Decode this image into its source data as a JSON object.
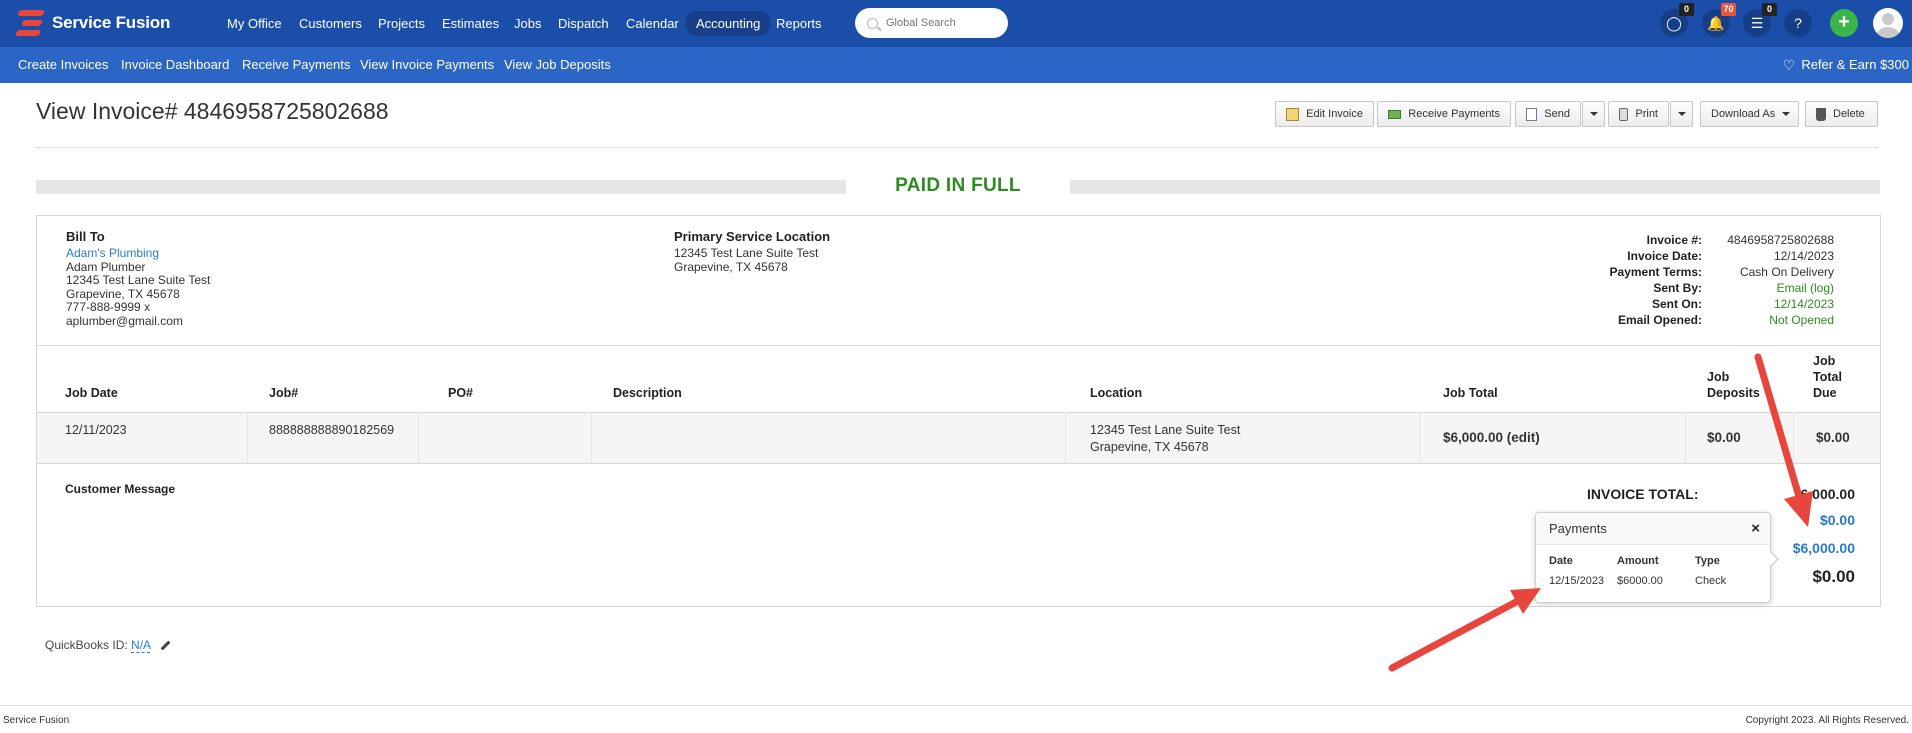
{
  "app": {
    "brand": "Service Fusion",
    "nav": [
      "My Office",
      "Customers",
      "Projects",
      "Estimates",
      "Jobs",
      "Dispatch",
      "Calendar",
      "Accounting",
      "Reports"
    ],
    "active_nav": "Accounting",
    "search_placeholder": "Global Search",
    "badges": {
      "chat": "0",
      "notifications": "70",
      "tasks": "0"
    },
    "help_label": "?",
    "plus_label": "+"
  },
  "subnav": {
    "items": [
      "Create Invoices",
      "Invoice Dashboard",
      "Receive Payments",
      "View Invoice Payments",
      "View Job Deposits"
    ],
    "refer": "Refer & Earn $300"
  },
  "page": {
    "title": "View Invoice# 4846958725802688",
    "buttons": {
      "edit": "Edit Invoice",
      "receive": "Receive Payments",
      "send": "Send",
      "print": "Print",
      "download": "Download As",
      "delete": "Delete"
    },
    "status": "PAID IN FULL"
  },
  "bill_to": {
    "label": "Bill To",
    "company": "Adam's Plumbing",
    "name": "Adam Plumber",
    "street": "12345 Test Lane Suite Test",
    "city": "Grapevine, TX 45678",
    "phone": "777-888-9999 x",
    "email": "aplumber@gmail.com"
  },
  "service_location": {
    "label": "Primary Service Location",
    "street": "12345 Test Lane Suite Test",
    "city": "Grapevine, TX 45678"
  },
  "meta": [
    {
      "label": "Invoice #:",
      "value": "4846958725802688",
      "color": "#333333"
    },
    {
      "label": "Invoice Date:",
      "value": "12/14/2023",
      "color": "#333333"
    },
    {
      "label": "Payment Terms:",
      "value": "Cash On Delivery",
      "color": "#333333"
    },
    {
      "label": "Sent By:",
      "value": "Email (log)",
      "color": "#2e8b1f"
    },
    {
      "label": "Sent On:",
      "value": "12/14/2023",
      "color": "#2e8b1f"
    },
    {
      "label": "Email Opened:",
      "value": "Not Opened",
      "color": "#2e8b1f"
    }
  ],
  "table": {
    "headers": {
      "job_date": "Job Date",
      "job_no": "Job#",
      "po": "PO#",
      "description": "Description",
      "location": "Location",
      "job_total": "Job Total",
      "deposits_1": "Job",
      "deposits_2": "Deposits",
      "due_1": "Job",
      "due_2": "Total",
      "due_3": "Due"
    },
    "row": {
      "job_date": "12/11/2023",
      "job_no": "888888888890182569",
      "po": "",
      "description": "",
      "location_1": "12345 Test Lane Suite Test",
      "location_2": "Grapevine, TX 45678",
      "job_total": "$6,000.00 (edit)",
      "deposits": "$0.00",
      "due": "$0.00"
    }
  },
  "totals": {
    "customer_message": "Customer Message",
    "invoice_total_label": "INVOICE TOTAL:",
    "invoice_total": "6,000.00",
    "line2": "$0.00",
    "line3": "$6,000.00",
    "balance": "$0.00"
  },
  "payments_popover": {
    "title": "Payments",
    "close": "×",
    "headers": [
      "Date",
      "Amount",
      "Type"
    ],
    "rows": [
      {
        "date": "12/15/2023",
        "amount": "$6000.00",
        "type": "Check"
      }
    ]
  },
  "quickbooks": {
    "label": "QuickBooks ID:",
    "value": "N/A"
  },
  "footer": {
    "left": "Service Fusion",
    "right": "Copyright 2023. All Rights Reserved."
  },
  "colors": {
    "nav": "#1b4ea8",
    "subnav": "#2b66c6",
    "paid": "#2e8b1f",
    "link": "#2a7ac7",
    "arrow": "#e8453c"
  }
}
